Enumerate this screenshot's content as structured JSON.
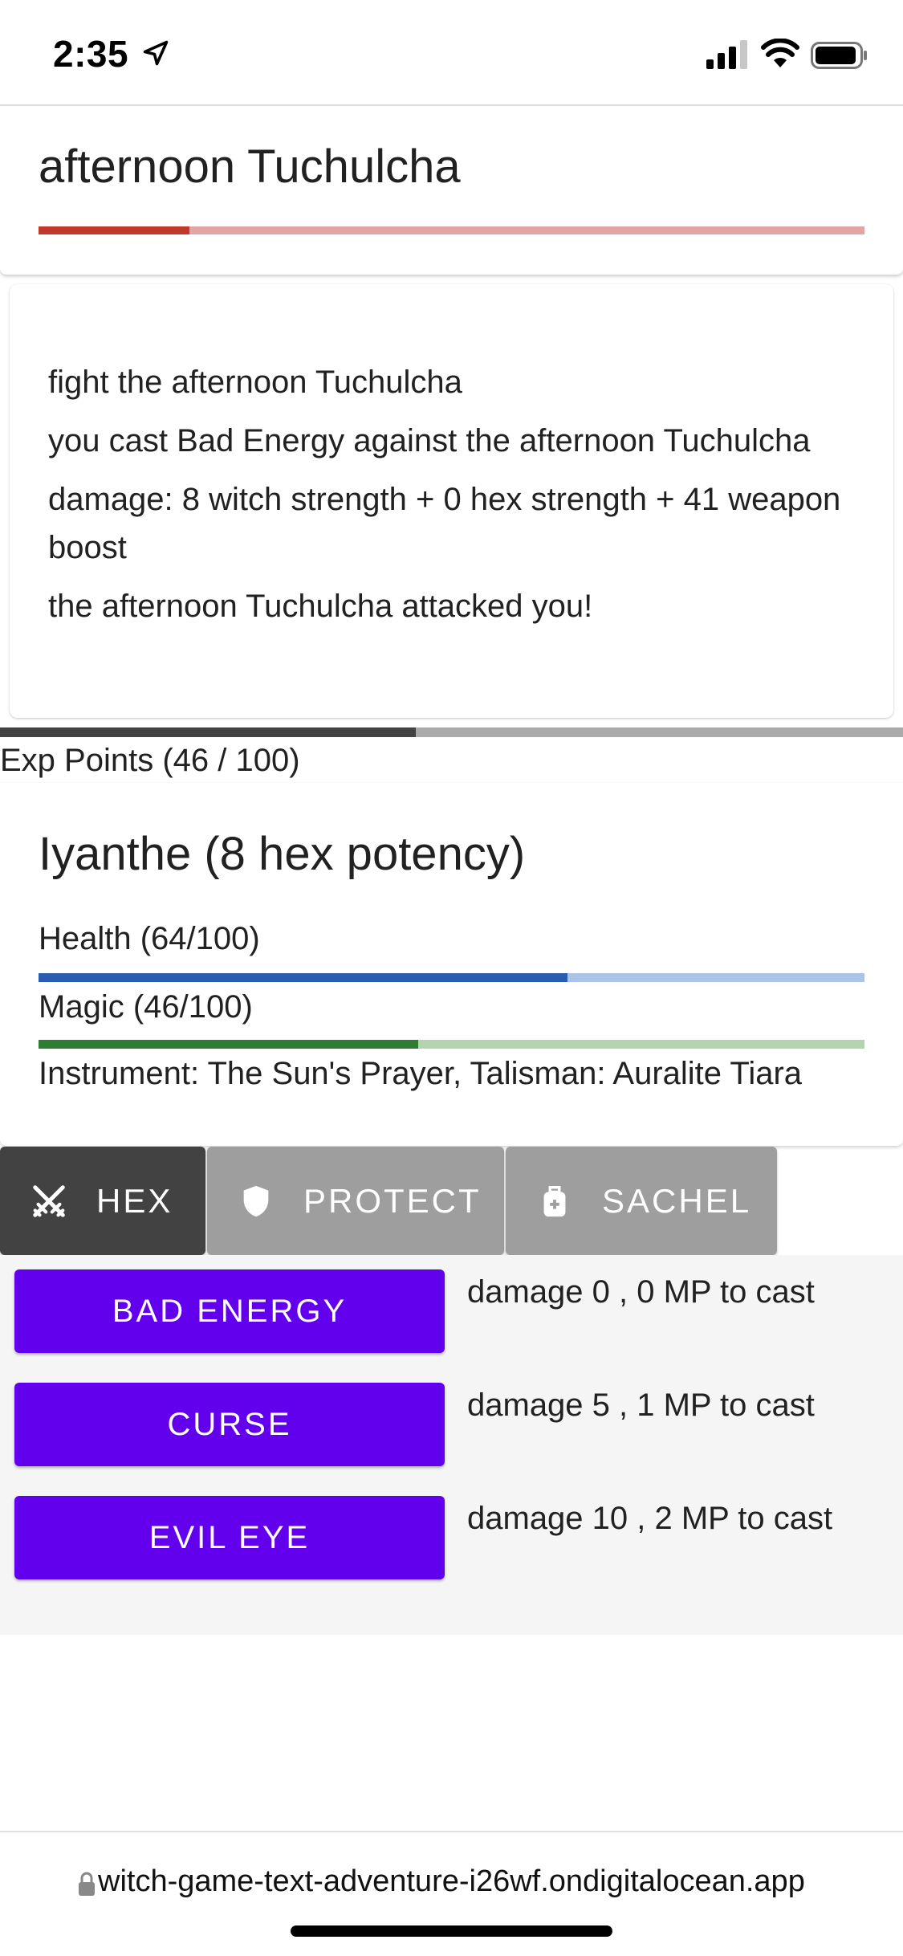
{
  "status_bar": {
    "time": "2:35"
  },
  "enemy": {
    "name": "afternoon Tuchulcha",
    "health_fraction": 0.183
  },
  "log": {
    "lines": [
      "fight the afternoon Tuchulcha",
      "you cast Bad Energy against the afternoon Tuchulcha",
      "damage: 8 witch strength + 0 hex strength + 41 weapon boost",
      "the afternoon Tuchulcha attacked you!"
    ]
  },
  "xp": {
    "label": "Exp Points (46 / 100)",
    "fraction": 0.46
  },
  "player": {
    "name": "Iyanthe (8 hex potency)",
    "health_label": "Health (64/100)",
    "health_fraction": 0.64,
    "magic_label": "Magic (46/100)",
    "magic_fraction": 0.46,
    "equipment": "Instrument: The Sun's Prayer, Talisman: Auralite Tiara"
  },
  "tabs": [
    {
      "label": "HEX",
      "icon": "crossed-swords-icon",
      "active": true
    },
    {
      "label": "PROTECT",
      "icon": "shield-icon",
      "active": false
    },
    {
      "label": "SACHEL",
      "icon": "backpack-icon",
      "active": false
    }
  ],
  "spells": [
    {
      "label": "BAD ENERGY",
      "description": "damage 0 , 0 MP to cast"
    },
    {
      "label": "CURSE",
      "description": "damage 5 , 1 MP to cast"
    },
    {
      "label": "EVIL EYE",
      "description": "damage 10 , 2 MP to cast"
    }
  ],
  "browser": {
    "url": "witch-game-text-adventure-i26wf.ondigitalocean.app"
  },
  "colors": {
    "accent": "#6200ee",
    "enemy_health": "#c0392b",
    "player_health": "#2a5db0",
    "player_magic": "#2e7d32",
    "active_tab": "#424242",
    "inactive_tab": "#9e9e9e"
  }
}
